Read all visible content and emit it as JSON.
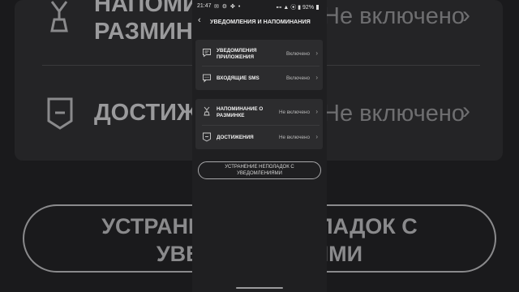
{
  "status_bar": {
    "time": "21:47",
    "left_icons": "✉ ⚙ ✤ •",
    "right_icons": "⊷ ▲ ⦿ ▮",
    "battery_percent": "92%"
  },
  "header": {
    "back_icon": "chevron-left-icon",
    "title": "УВЕДОМЛЕНИЯ И НАПОМИНАНИЯ"
  },
  "notifications_group": {
    "items": [
      {
        "icon": "message-icon",
        "label_line1": "УВЕДОМЛЕНИЯ",
        "label_line2": "ПРИЛОЖЕНИЯ",
        "value": "Включено"
      },
      {
        "icon": "sms-icon",
        "label_line1": "ВХОДЯЩИЕ SMS",
        "label_line2": "",
        "value": "Включено"
      }
    ]
  },
  "reminders_group": {
    "items": [
      {
        "icon": "stretch-icon",
        "label_line1": "НАПОМИНАНИЕ О",
        "label_line2": "РАЗМИНКЕ",
        "value": "Не включено"
      },
      {
        "icon": "achievement-badge-icon",
        "label_line1": "ДОСТИЖЕНИЯ",
        "label_line2": "",
        "value": "Не включено"
      }
    ]
  },
  "troubleshoot_button": {
    "line1": "УСТРАНЕНИЕ НЕПОЛАДОК С",
    "line2": "УВЕДОМЛЕНИЯМИ"
  },
  "background": {
    "row1_line1": "НАПОМИНАНИЕ О",
    "row1_line2": "РАЗМИНКЕ",
    "row1_value": "Не включено",
    "row2_label": "ДОСТИЖЕНИЯ",
    "row2_value": "Не включено",
    "pill_line1": "УСТРАНЕНИЕ НЕПОЛАДОК С",
    "pill_line2": "УВЕДОМЛЕНИЯМИ"
  },
  "colors": {
    "background": "#1c1c1e",
    "phone_background": "#1f1f21",
    "group_background": "#2c2c2e",
    "text_primary": "#f0f0f0",
    "text_secondary": "#b8b8b8"
  }
}
